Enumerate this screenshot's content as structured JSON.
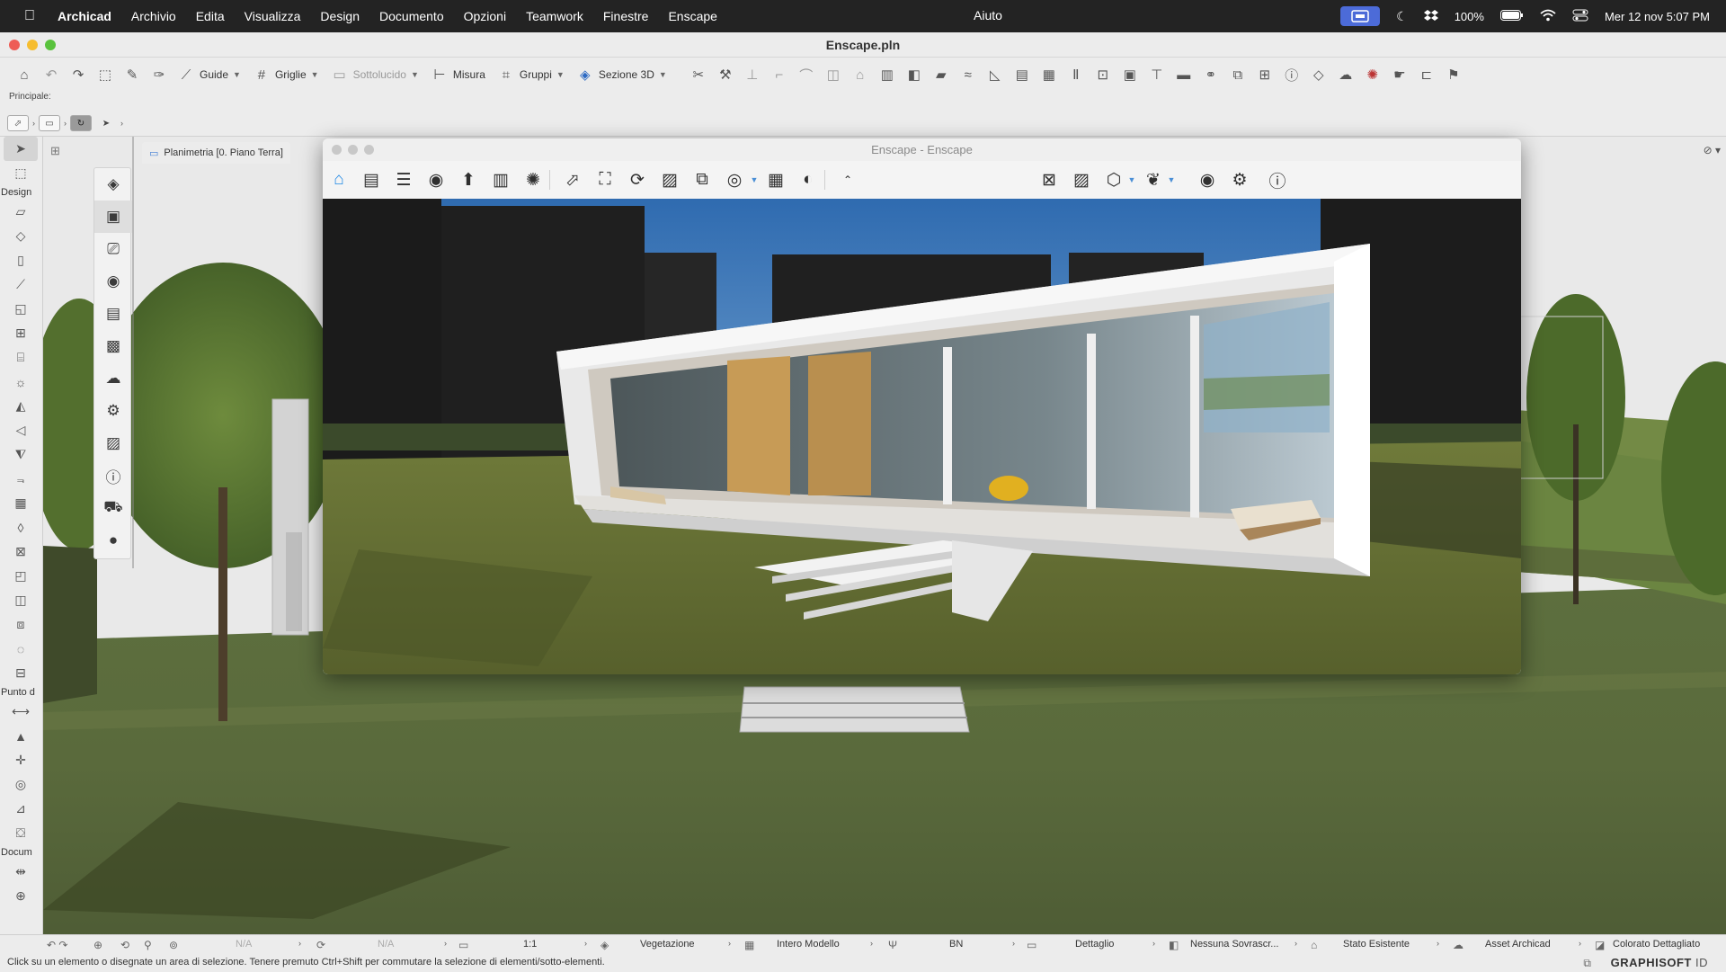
{
  "menubar": {
    "apple_icon": "apple-icon",
    "items": [
      "Archicad",
      "Archivio",
      "Edita",
      "Visualizza",
      "Design",
      "Documento",
      "Opzioni",
      "Teamwork",
      "Finestre",
      "Enscape"
    ],
    "help": "Aiuto",
    "battery": "100%",
    "datetime": "Mer 12 nov  5:07 PM"
  },
  "window": {
    "title": "Enscape.pln"
  },
  "toolbar": {
    "guide": "Guide",
    "griglie": "Griglie",
    "sottolucido": "Sottolucido",
    "misura": "Misura",
    "gruppi": "Gruppi",
    "sezione3d": "Sezione 3D"
  },
  "infobox": {
    "label": "Principale:"
  },
  "toolbox": {
    "design_label": "Design",
    "punto_label": "Punto d",
    "docum_label": "Docum"
  },
  "viewport": {
    "tab_label": "Planimetria [0. Piano Terra]"
  },
  "enscape": {
    "title": "Enscape - Enscape",
    "accent": "#1e88e5"
  },
  "statusbar": {
    "na1": "N/A",
    "na2": "N/A",
    "scale": "1:1",
    "layer": "Vegetazione",
    "model": "Intero Modello",
    "pen": "BN",
    "detail": "Dettaglio",
    "override": "Nessuna Sovrascr...",
    "renovation": "Stato Esistente",
    "asset": "Asset Archicad",
    "colored": "Colorato Dettagliato",
    "help": "Click su un elemento o disegnate un area di selezione. Tenere premuto Ctrl+Shift per commutare la selezione di elementi/sotto-elementi.",
    "brand": "GRAPHISOFT",
    "brand_suffix": "ID"
  }
}
